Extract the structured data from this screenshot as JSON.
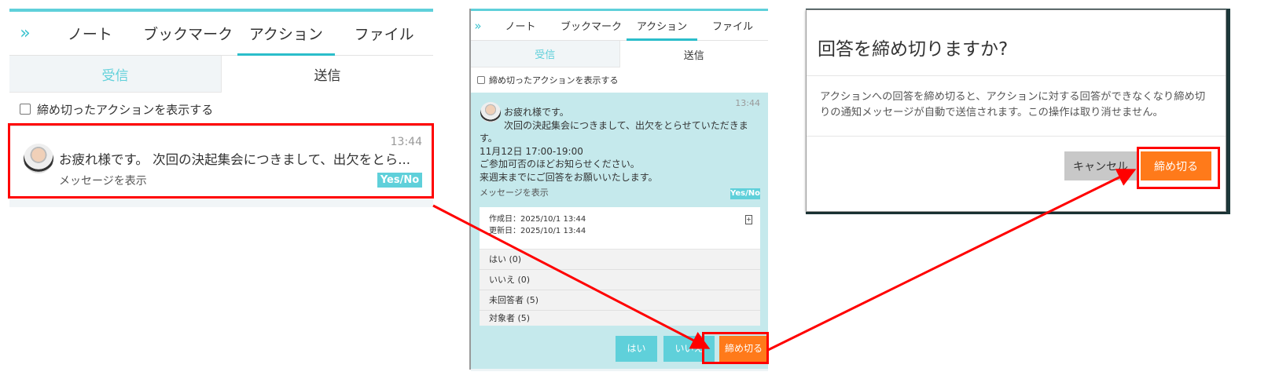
{
  "tabs": [
    "ノート",
    "ブックマーク",
    "アクション",
    "ファイル"
  ],
  "subtabs": {
    "received": "受信",
    "sent": "送信"
  },
  "show_closed": "締め切ったアクションを表示する",
  "list_item": {
    "time": "13:44",
    "preview": "お疲れ様です。 次回の決起集会につきまして、出欠をとら...",
    "show_message": "メッセージを表示",
    "badge": "Yes/No"
  },
  "detail": {
    "time": "13:44",
    "lines": [
      "お疲れ様です。",
      "次回の決起集会につきまして、出欠をとらせていただきま",
      "す。",
      "11月12日 17:00-19:00",
      "ご参加可否のほどお知らせください。",
      "来週末までにご回答をお願いいたします。"
    ],
    "show_message": "メッセージを表示",
    "badge": "Yes/No",
    "created": "作成日：2025/10/1 13:44",
    "updated": "更新日：2025/10/1 13:44",
    "rows": [
      "はい (0)",
      "いいえ (0)",
      "未回答者 (5)",
      "対象者 (5)"
    ],
    "buttons": {
      "yes": "はい",
      "no": "いいえ",
      "close": "締め切る"
    }
  },
  "dialog": {
    "title": "回答を締め切りますか?",
    "body": "アクションへの回答を締め切ると、アクションに対する回答ができなくなり締め切りの通知メッセージが自動で送信されます。この操作は取り消せません。",
    "cancel": "キャンセル",
    "confirm": "締め切る"
  },
  "colors": {
    "accent": "#2bbdca",
    "orange": "#ff7a1a",
    "highlight": "#ff0000"
  }
}
